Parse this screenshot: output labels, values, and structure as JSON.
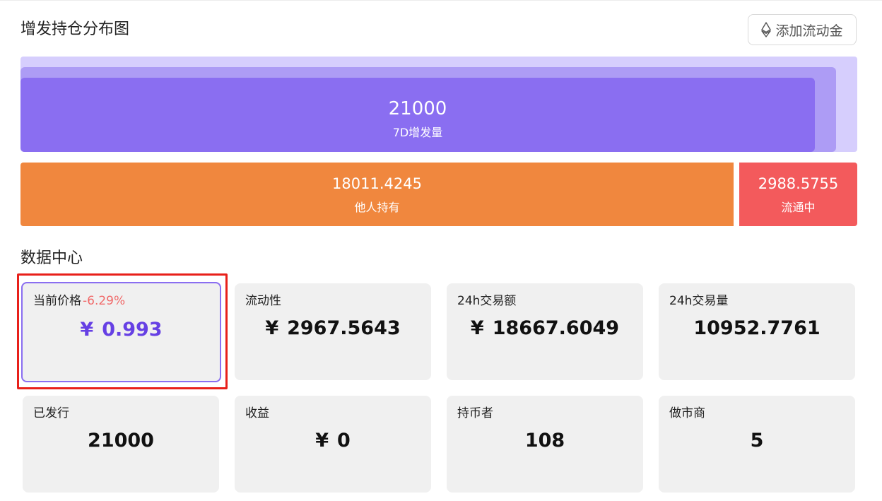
{
  "header": {
    "title": "增发持仓分布图",
    "add_liquidity_label": "添加流动金"
  },
  "mint": {
    "amount": "21000",
    "label": "7D增发量"
  },
  "holdings": {
    "others": {
      "amount": "18011.4245",
      "label": "他人持有"
    },
    "circulating": {
      "amount": "2988.5755",
      "label": "流通中"
    }
  },
  "data_center": {
    "title": "数据中心",
    "cards": [
      {
        "label": "当前价格",
        "change": "-6.29%",
        "currency": "¥",
        "value": "0.993"
      },
      {
        "label": "流动性",
        "currency": "¥",
        "value": "2967.5643"
      },
      {
        "label": "24h交易额",
        "currency": "¥",
        "value": "18667.6049"
      },
      {
        "label": "24h交易量",
        "value": "10952.7761"
      },
      {
        "label": "已发行",
        "value": "21000"
      },
      {
        "label": "收益",
        "currency": "¥",
        "value": "0"
      },
      {
        "label": "持币者",
        "value": "108"
      },
      {
        "label": "做市商",
        "value": "5"
      }
    ]
  },
  "colors": {
    "accent_purple": "#8a6ef1",
    "orange": "#f0873e",
    "red": "#f35a5c",
    "highlight": "#e8201a"
  },
  "icons": {
    "add_liquidity": "ethereum-diamond-icon"
  }
}
